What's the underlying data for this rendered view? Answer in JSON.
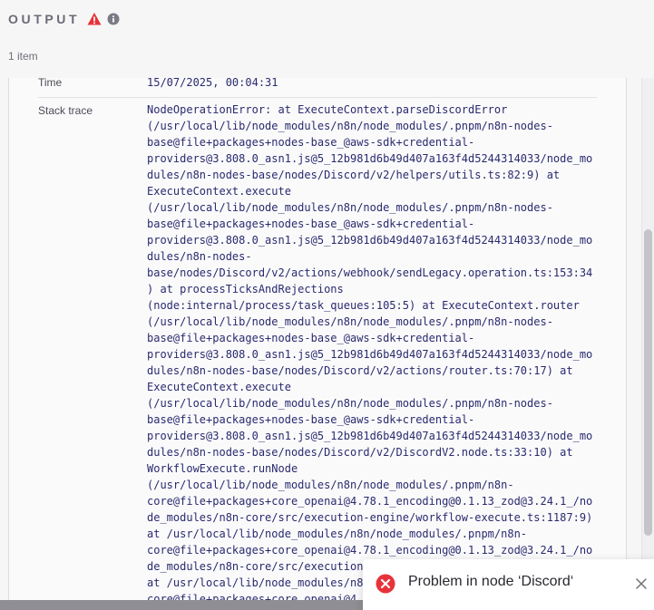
{
  "header": {
    "title": "OUTPUT",
    "warning_icon": "warning-triangle-icon",
    "info_icon": "info-circle-icon",
    "warning_color": "#e8323a"
  },
  "output": {
    "item_count": "1 item",
    "rows": {
      "time": {
        "label": "Time",
        "value": "15/07/2025, 00:04:31"
      },
      "stack_trace": {
        "label": "Stack trace",
        "lines": [
          "NodeOperationError: at ExecuteContext.parseDiscordError",
          "(/usr/local/lib/node_modules/n8n/node_modules/.pnpm/n8n-nodes-",
          "base@file+packages+nodes-base_@aws-sdk+credential-",
          "providers@3.808.0_asn1.js@5_12b981d6b49d407a163f4d5244314033/node_mo",
          "dules/n8n-nodes-base/nodes/Discord/v2/helpers/utils.ts:82:9) at",
          "ExecuteContext.execute",
          "(/usr/local/lib/node_modules/n8n/node_modules/.pnpm/n8n-nodes-",
          "base@file+packages+nodes-base_@aws-sdk+credential-",
          "providers@3.808.0_asn1.js@5_12b981d6b49d407a163f4d5244314033/node_mo",
          "dules/n8n-nodes-",
          "base/nodes/Discord/v2/actions/webhook/sendLegacy.operation.ts:153:34",
          ") at processTicksAndRejections",
          "(node:internal/process/task_queues:105:5) at ExecuteContext.router",
          "(/usr/local/lib/node_modules/n8n/node_modules/.pnpm/n8n-nodes-",
          "base@file+packages+nodes-base_@aws-sdk+credential-",
          "providers@3.808.0_asn1.js@5_12b981d6b49d407a163f4d5244314033/node_mo",
          "dules/n8n-nodes-base/nodes/Discord/v2/actions/router.ts:70:17) at",
          "ExecuteContext.execute",
          "(/usr/local/lib/node_modules/n8n/node_modules/.pnpm/n8n-nodes-",
          "base@file+packages+nodes-base_@aws-sdk+credential-",
          "providers@3.808.0_asn1.js@5_12b981d6b49d407a163f4d5244314033/node_mo",
          "dules/n8n-nodes-base/nodes/Discord/v2/DiscordV2.node.ts:33:10) at",
          "WorkflowExecute.runNode",
          "(/usr/local/lib/node_modules/n8n/node_modules/.pnpm/n8n-",
          "core@file+packages+core_openai@4.78.1_encoding@0.1.13_zod@3.24.1_/no",
          "de_modules/n8n-core/src/execution-engine/workflow-execute.ts:1187:9)",
          "at /usr/local/lib/node_modules/n8n/node_modules/.pnpm/n8n-",
          "core@file+packages+core_openai@4.78.1_encoding@0.1.13_zod@3.24.1_/no",
          "de_modules/n8n-core/src/execution",
          "at /usr/local/lib/node_modules/n8",
          "core@file+packages+core_openai@4"
        ]
      }
    }
  },
  "toast": {
    "message": "Problem in node ‘Discord‘",
    "error_icon": "error-circle-icon",
    "close_icon": "close-icon",
    "error_color": "#e8323a"
  }
}
